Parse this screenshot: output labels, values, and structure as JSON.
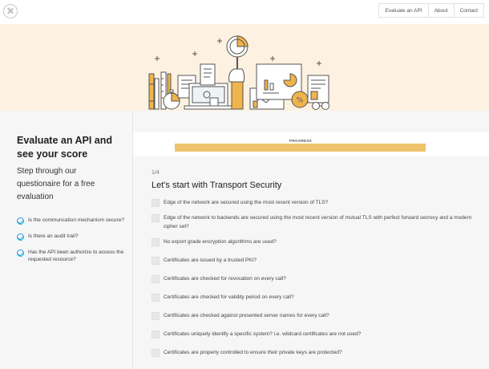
{
  "topbar": {
    "nav": [
      "Evaluate an API",
      "About",
      "Contact"
    ]
  },
  "hero": {
    "icons": [
      "books-icon",
      "pencil-ruler-icon",
      "stopwatch-icon",
      "document-icon",
      "laptop-icon",
      "scroll-icon",
      "hand-magnifier-icon",
      "dollar-coin-icon",
      "chart-board-icon",
      "presentation-icon",
      "percent-badge-icon",
      "glasses-icon",
      "cube-icon"
    ],
    "colors": {
      "background": "#fdf1e1",
      "accent": "#f0b44c",
      "line": "#555555"
    }
  },
  "left": {
    "title": "Evaluate an API and see your score",
    "subtitle": "Step through our questionaire for a free evaluation",
    "checklist": [
      "Is the communcation mechanism secure?",
      "Is there an audit trail?",
      "Has the API been authorize to access the requested resource?"
    ]
  },
  "progress": {
    "label": "PROGRESS",
    "fraction": 1.0
  },
  "section": {
    "step": "1/4",
    "title": "Let's start with Transport Security",
    "questions": [
      "Edge of the network are secured using the most recent version of TLS?",
      "Edge of the network to backends are secured using the most recent version of mutual TLS with perfect forward secrecy and a modern cipher set?",
      "No export grade encryption algorithms are used?",
      "Certificates are issued by a trusted PKI?",
      "Certificates are checked for revocation on every call?",
      "Certificates are checked for validity period on every call?",
      "Certificates are checked against presented server names for every call?",
      "Certificates uniquely identify a specific system? i.e. wildcard certificates are not used?",
      "Certificates are properly controlled to ensure their private keys are protected?"
    ]
  }
}
